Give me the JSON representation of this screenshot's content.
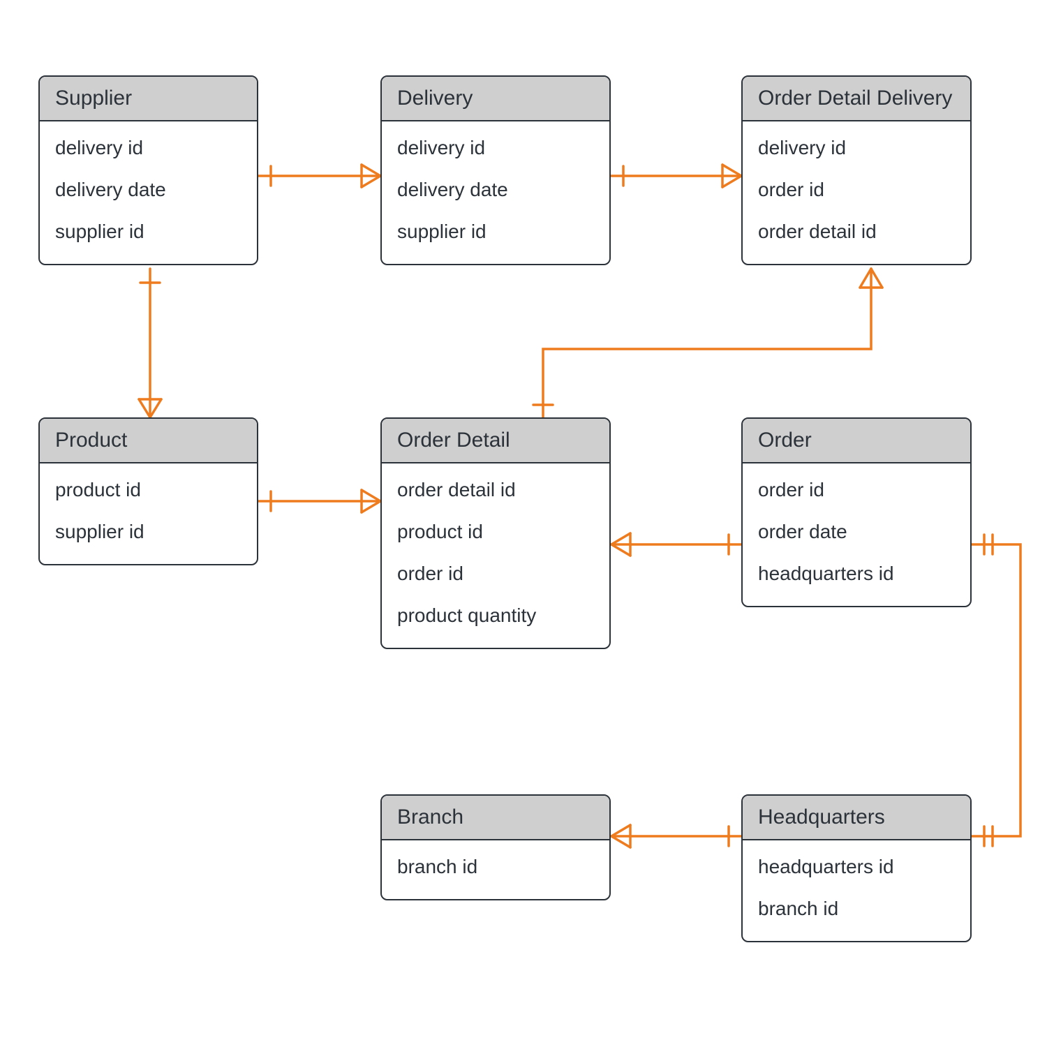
{
  "entities": {
    "supplier": {
      "title": "Supplier",
      "attrs": [
        "delivery id",
        "delivery date",
        "supplier id"
      ]
    },
    "delivery": {
      "title": "Delivery",
      "attrs": [
        "delivery id",
        "delivery date",
        "supplier id"
      ]
    },
    "orderDetailDelivery": {
      "title": "Order Detail Delivery",
      "attrs": [
        "delivery id",
        "order id",
        "order detail id"
      ]
    },
    "product": {
      "title": "Product",
      "attrs": [
        "product id",
        "supplier id"
      ]
    },
    "orderDetail": {
      "title": "Order Detail",
      "attrs": [
        "order detail id",
        "product id",
        "order id",
        "product quantity"
      ]
    },
    "order": {
      "title": "Order",
      "attrs": [
        "order id",
        "order date",
        "headquarters id"
      ]
    },
    "branch": {
      "title": "Branch",
      "attrs": [
        "branch id"
      ]
    },
    "headquarters": {
      "title": "Headquarters",
      "attrs": [
        "headquarters id",
        "branch id"
      ]
    }
  },
  "colors": {
    "connector": "#ee7b1d",
    "entityBorder": "#2c3239",
    "entityHeader": "#cfcfcf"
  },
  "relationships": [
    {
      "from": "Supplier",
      "to": "Delivery",
      "type": "one-to-many"
    },
    {
      "from": "Delivery",
      "to": "Order Detail Delivery",
      "type": "one-to-many"
    },
    {
      "from": "Supplier",
      "to": "Product",
      "type": "one-to-many"
    },
    {
      "from": "Product",
      "to": "Order Detail",
      "type": "one-to-many"
    },
    {
      "from": "Order Detail",
      "to": "Order Detail Delivery",
      "type": "one-to-many"
    },
    {
      "from": "Order",
      "to": "Order Detail",
      "type": "one-to-many"
    },
    {
      "from": "Headquarters",
      "to": "Order",
      "type": "one-to-one"
    },
    {
      "from": "Headquarters",
      "to": "Branch",
      "type": "one-to-many"
    }
  ]
}
